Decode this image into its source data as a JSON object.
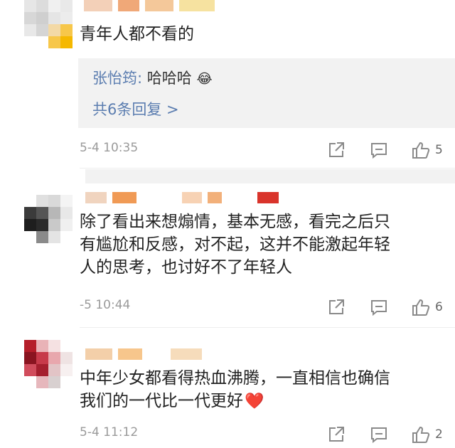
{
  "comments": [
    {
      "text": "青年人都不看的",
      "reply_user": "张怡筠:",
      "reply_text": "哈哈哈",
      "reply_emoji": "😂",
      "more_replies": "共6条回复 >",
      "timestamp": "5-4 10:35",
      "likes": "5"
    },
    {
      "text_lines": [
        "除了看出来想煽情，基本无感，看完之后只",
        "有尴尬和反感，对不起，这并不能激起年轻",
        "人的思考，也讨好不了年轻人"
      ],
      "timestamp": "-5 10:44",
      "likes": "6"
    },
    {
      "text_lines": [
        "中年少女都看得热血沸腾，一直相信也确信",
        "我们的一代比一代更好"
      ],
      "text_emoji": "❤️",
      "timestamp": "5-4 11:12",
      "likes": "2"
    }
  ],
  "icons": [
    "share-icon",
    "comment-icon",
    "like-icon"
  ],
  "colors": {
    "link": "#5b7db0",
    "timestamp": "#9a9a9a",
    "reply_bg": "#f2f2f2",
    "heart": "#e8363a"
  }
}
